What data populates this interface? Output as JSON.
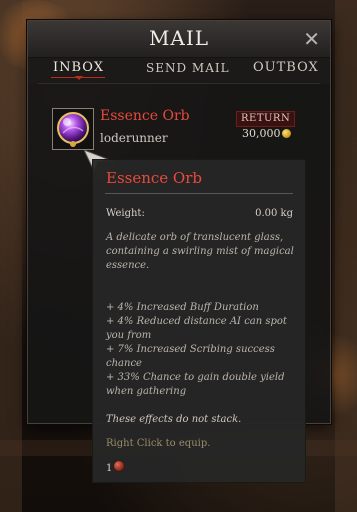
{
  "window": {
    "title": "MAIL",
    "close_glyph": "✕"
  },
  "tabs": [
    {
      "label": "INBOX",
      "active": true
    },
    {
      "label": "SEND MAIL",
      "active": false
    },
    {
      "label": "OUTBOX",
      "active": false
    }
  ],
  "mail": {
    "item_name": "Essence Orb",
    "sender": "loderunner",
    "return_label": "RETURN",
    "price": "30,000",
    "icon": "essence-orb-icon",
    "coin_icon": "gold-coin-icon"
  },
  "tooltip": {
    "title": "Essence Orb",
    "weight_label": "Weight:",
    "weight_value": "0.00 kg",
    "description": "A delicate orb of translucent glass, containing a swirling mist of magical essence.",
    "effects": [
      "+ 4% Increased Buff Duration",
      "+ 4% Reduced distance AI can spot you from",
      "+ 7% Increased Scribing success chance",
      "+ 33% Chance to gain double yield when gathering"
    ],
    "note": "These effects do not stack.",
    "equip_hint": "Right Click to equip.",
    "count": "1"
  },
  "colors": {
    "accent_red": "#b92d1f",
    "item_name_red": "#e84a3d",
    "panel_bg": "#161616"
  }
}
